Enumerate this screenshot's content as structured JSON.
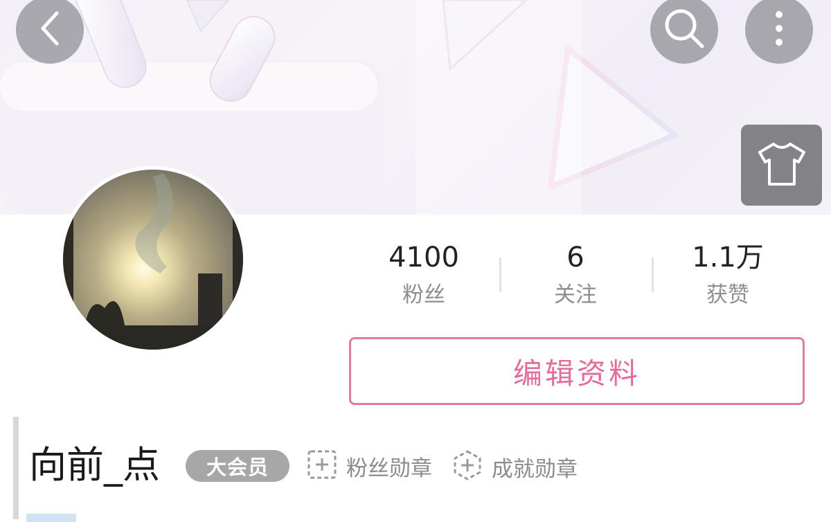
{
  "header": {
    "back_icon": "chevron-left-icon",
    "search_icon": "search-icon",
    "more_icon": "more-vertical-icon",
    "theme_icon": "tshirt-icon"
  },
  "stats": [
    {
      "value": "4100",
      "label": "粉丝"
    },
    {
      "value": "6",
      "label": "关注"
    },
    {
      "value": "1.1万",
      "label": "获赞"
    }
  ],
  "profile": {
    "edit_label": "编辑资料",
    "username": "向前_点",
    "vip_label": "大会员",
    "fan_medal_label": "粉丝勋章",
    "achievement_medal_label": "成就勋章"
  },
  "colors": {
    "accent": "#e36d9a",
    "badge_gray": "#a7a7a7",
    "button_overlay": "#8c8c91"
  }
}
